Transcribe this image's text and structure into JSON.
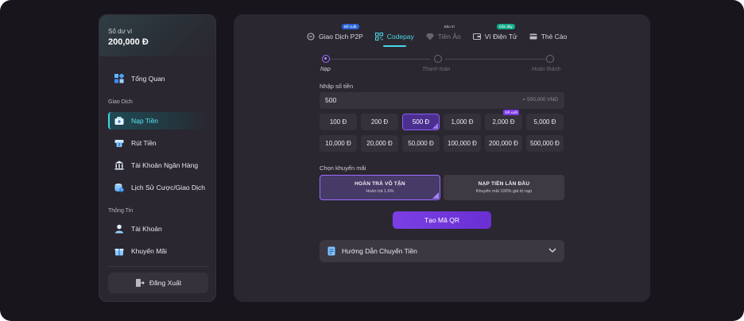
{
  "sidebar": {
    "balance_label": "Số dư ví",
    "balance_value": "200,000 Đ",
    "overview": "Tổng Quan",
    "section_transactions": "Giao Dịch",
    "items": [
      {
        "label": "Nạp Tiền"
      },
      {
        "label": "Rút Tiền"
      },
      {
        "label": "Tài Khoản Ngân Hàng"
      },
      {
        "label": "Lịch Sử Cược/Giao Dịch"
      }
    ],
    "section_info": "Thông Tin",
    "info_items": [
      {
        "label": "Tài Khoản"
      },
      {
        "label": "Khuyến Mãi"
      }
    ],
    "logout": "Đăng Xuất"
  },
  "tabs": [
    {
      "label": "Giao Dịch P2P",
      "badge": "Đề xuất"
    },
    {
      "label": "Codepay",
      "badge": ""
    },
    {
      "label": "Tiền Ảo",
      "badge": "Bảo trì"
    },
    {
      "label": "Ví Điện Tử",
      "badge": "Gần đây"
    },
    {
      "label": "Thẻ Cào",
      "badge": ""
    }
  ],
  "steps": [
    {
      "label": "Nạp"
    },
    {
      "label": "Thanh toán"
    },
    {
      "label": "Hoàn thành"
    }
  ],
  "amount": {
    "label": "Nhập số tiền",
    "value": "500",
    "hint": "= 500,000 VND"
  },
  "amount_options": [
    "100 Đ",
    "200 Đ",
    "500 Đ",
    "1,000 Đ",
    "2,000 Đ",
    "5,000 Đ",
    "10,000 Đ",
    "20,000 Đ",
    "50,000 Đ",
    "100,000 Đ",
    "200,000 Đ",
    "500,000 Đ"
  ],
  "selected_amount": "500 Đ",
  "amount_badge": "Đề xuất",
  "promo": {
    "label": "Chọn khuyến mãi",
    "options": [
      {
        "title": "HOÀN TRẢ VÔ TẬN",
        "subtitle": "Hoàn trả 1.6%"
      },
      {
        "title": "NẠP TIỀN LẦN ĐẦU",
        "subtitle": "Khuyến mãi 100% giá trị nạp"
      }
    ]
  },
  "qr_button": "Tạo Mã QR",
  "guide": "Hướng Dẫn Chuyển Tiền",
  "colors": {
    "accent_cyan": "#48d9e8",
    "accent_purple": "#7b3fe4",
    "panel": "#2a2730",
    "background": "#18151d"
  }
}
